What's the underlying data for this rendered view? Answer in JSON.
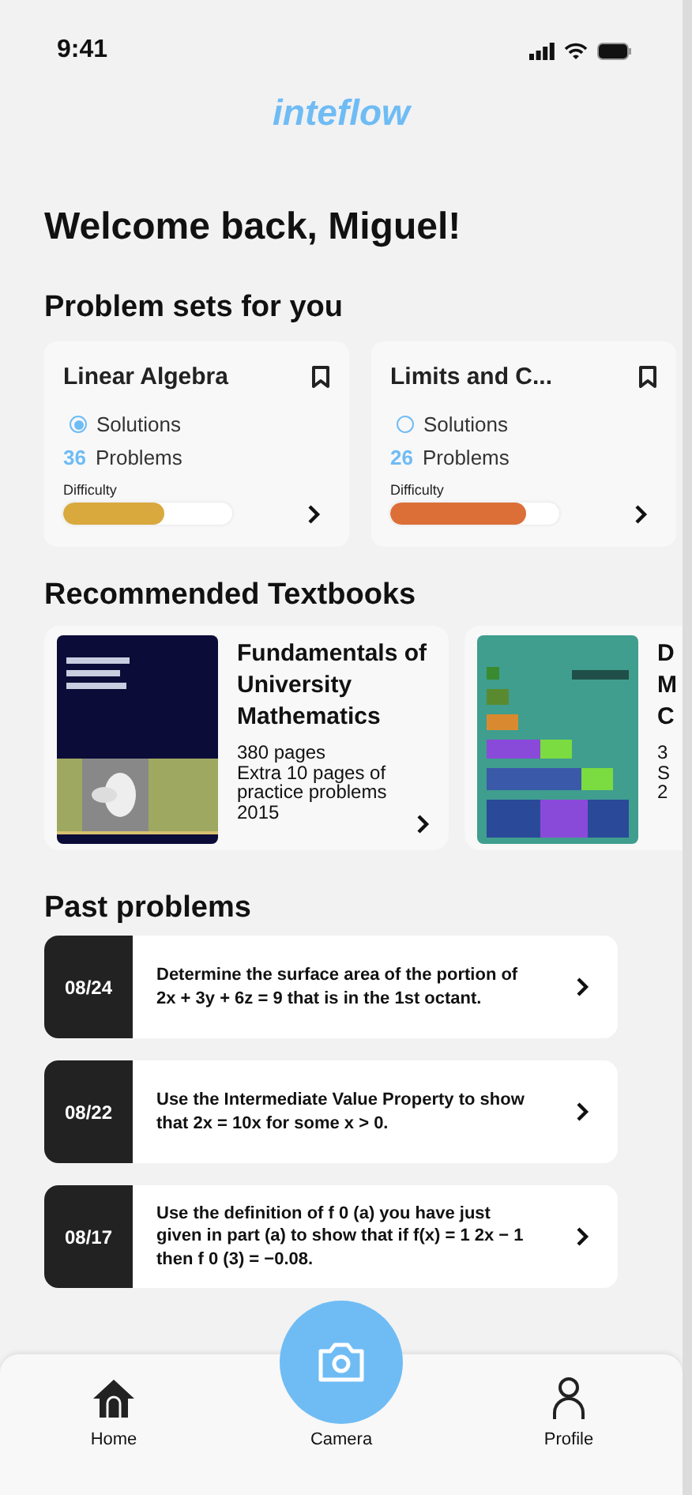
{
  "status_bar": {
    "time": "9:41"
  },
  "logo": "inteflow",
  "greeting": "Welcome back, Miguel!",
  "problem_sets": {
    "title": "Problem sets for you",
    "items": [
      {
        "title": "Linear Algebra",
        "solutions_label": "Solutions",
        "solutions_selected": true,
        "count": "36",
        "count_label": "Problems",
        "difficulty_label": "Difficulty",
        "level": 0.6,
        "color": "#d9a93e"
      },
      {
        "title": "Limits and C...",
        "solutions_label": "Solutions",
        "solutions_selected": false,
        "count": "26",
        "count_label": "Problems",
        "difficulty_label": "Difficulty",
        "level": 0.8,
        "color": "#dc6f38"
      }
    ]
  },
  "textbooks": {
    "title": "Recommended Textbooks",
    "items": [
      {
        "title_lines": [
          "Fundamentals of",
          "University",
          "Mathematics"
        ],
        "detail_lines": [
          "380 pages",
          "Extra 10 pages of",
          "practice problems",
          "2015"
        ]
      },
      {
        "title_lines": [
          "D",
          "M",
          "C"
        ],
        "detail_lines": [
          "3",
          "S",
          "2"
        ]
      }
    ]
  },
  "past_problems": {
    "title": "Past problems",
    "items": [
      {
        "date": "08/24",
        "text": "Determine the surface area of the portion of 2x + 3y + 6z = 9 that is in the 1st octant."
      },
      {
        "date": "08/22",
        "text": "Use the Intermediate Value Property to show that 2x = 10x for some x > 0."
      },
      {
        "date": "08/17",
        "text": "Use the definition of f 0 (a) you have just given in part (a) to show that if f(x) = 1 2x − 1 then f 0 (3) = −0.08."
      }
    ]
  },
  "nav": [
    {
      "kind": "home",
      "label": "Home"
    },
    {
      "kind": "camera",
      "label": "Camera"
    },
    {
      "kind": "profile",
      "label": "Profile"
    }
  ]
}
